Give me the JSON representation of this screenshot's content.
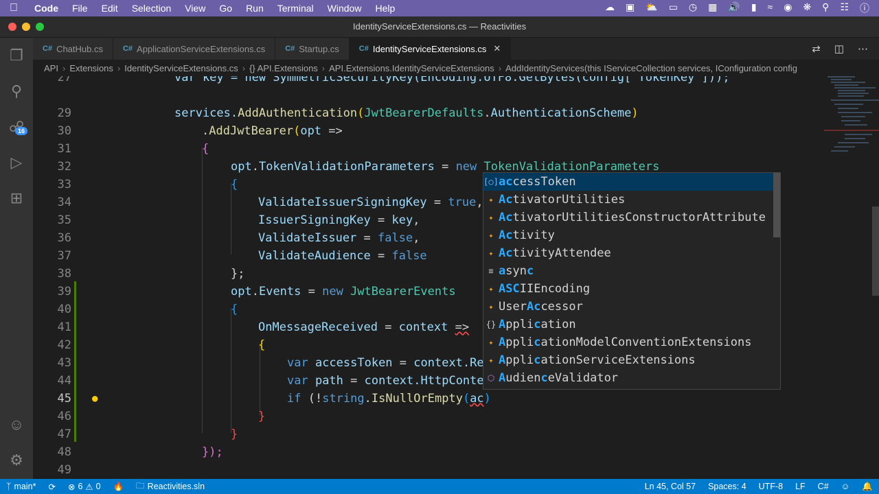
{
  "menubar": {
    "app": "Code",
    "items": [
      "File",
      "Edit",
      "Selection",
      "View",
      "Go",
      "Run",
      "Terminal",
      "Window",
      "Help"
    ]
  },
  "window": {
    "title": "IdentityServiceExtensions.cs — Reactivities"
  },
  "activity": {
    "source_control_badge": "16"
  },
  "tabs": [
    {
      "label": "ChatHub.cs"
    },
    {
      "label": "ApplicationServiceExtensions.cs"
    },
    {
      "label": "Startup.cs"
    },
    {
      "label": "IdentityServiceExtensions.cs",
      "active": true
    }
  ],
  "tab_lang": "C#",
  "breadcrumbs": [
    "API",
    "Extensions",
    "IdentityServiceExtensions.cs",
    "{} API.Extensions",
    "API.Extensions.IdentityServiceExtensions",
    "AddIdentityServices(this IServiceCollection services, IConfiguration config"
  ],
  "code": {
    "line_numbers": [
      "27",
      "29",
      "30",
      "31",
      "32",
      "33",
      "34",
      "35",
      "36",
      "37",
      "38",
      "39",
      "40",
      "41",
      "42",
      "43",
      "44",
      "45",
      "46",
      "47",
      "48",
      "49"
    ],
    "l27": "var key = new SymmetricSecurityKey(Encoding.UTF8.GetBytes(config[\"TokenKey\"]));",
    "l29a": "services.",
    "l29b": "AddAuthentication",
    "l29c": "(",
    "l29d": "JwtBearerDefaults",
    "l29e": ".",
    "l29f": "AuthenticationScheme",
    "l29g": ")",
    "l30a": ".",
    "l30b": "AddJwtBearer",
    "l30c": "(",
    "l30d": "opt",
    "l30e": " =>",
    "l31": "{",
    "l32a": "opt",
    "l32b": ".",
    "l32c": "TokenValidationParameters",
    "l32d": " = ",
    "l32e": "new",
    "l32f": " TokenValidationParameters",
    "l33": "{",
    "l34a": "ValidateIssuerSigningKey",
    "l34b": " = ",
    "l34c": "true",
    "l34d": ",",
    "l35a": "IssuerSigningKey",
    "l35b": " = ",
    "l35c": "key",
    "l35d": ",",
    "l36a": "ValidateIssuer",
    "l36b": " = ",
    "l36c": "false",
    "l36d": ",",
    "l37a": "ValidateAudience",
    "l37b": " = ",
    "l37c": "false",
    "l38": "};",
    "l39a": "opt",
    "l39b": ".",
    "l39c": "Events",
    "l39d": " = ",
    "l39e": "new",
    "l39f": " JwtBearerEvents",
    "l40": "{",
    "l41a": "OnMessageReceived",
    "l41b": " = ",
    "l41c": "context",
    "l41d": " ",
    "l41e": "=>",
    "l42": "{",
    "l43a": "var",
    "l43b": " accessToken",
    "l43c": " = ",
    "l43d": "context",
    "l43e": ".Re",
    "l44a": "var",
    "l44b": " path",
    "l44c": " = ",
    "l44d": "context",
    "l44e": ".HttpConte",
    "l45a": "if",
    "l45b": " (!",
    "l45c": "string",
    "l45d": ".",
    "l45e": "IsNullOrEmpty",
    "l45f": "(",
    "l45g": "ac",
    "l45h": ")",
    "l46": "}",
    "l47": "}",
    "l48a": "});"
  },
  "suggest": [
    {
      "icon": "prop",
      "pre": "",
      "m": "ac",
      "post": "cessToken"
    },
    {
      "icon": "cls",
      "pre": "",
      "m": "Ac",
      "post": "tivatorUtilities"
    },
    {
      "icon": "cls",
      "pre": "",
      "m": "Ac",
      "post": "tivatorUtilitiesConstructorAttribute"
    },
    {
      "icon": "cls",
      "pre": "",
      "m": "Ac",
      "post": "tivity"
    },
    {
      "icon": "cls",
      "pre": "",
      "m": "Ac",
      "post": "tivityAttendee"
    },
    {
      "icon": "kw",
      "pre": "",
      "m": "a",
      "post": "syn",
      "m2": "c",
      "post2": ""
    },
    {
      "icon": "cls",
      "pre": "",
      "m": "A",
      "post": "S",
      "m2": "C",
      "post2": "IIEncoding"
    },
    {
      "icon": "cls",
      "pre": "User",
      "m": "Ac",
      "post": "cessor"
    },
    {
      "icon": "ns",
      "pre": "",
      "m": "A",
      "post": "ppli",
      "m2": "c",
      "post2": "ation"
    },
    {
      "icon": "cls",
      "pre": "",
      "m": "A",
      "post": "ppli",
      "m2": "c",
      "post2": "ationModelConventionExtensions"
    },
    {
      "icon": "cls",
      "pre": "",
      "m": "A",
      "post": "ppli",
      "m2": "c",
      "post2": "ationServiceExtensions"
    },
    {
      "icon": "cls2",
      "pre": "",
      "m": "A",
      "post": "udien",
      "m2": "c",
      "post2": "eValidator"
    }
  ],
  "statusbar": {
    "branch": "main*",
    "errors": "6",
    "warnings": "0",
    "solution": "Reactivities.sln",
    "position": "Ln 45, Col 57",
    "spaces": "Spaces: 4",
    "encoding": "UTF-8",
    "eol": "LF",
    "language": "C#"
  }
}
